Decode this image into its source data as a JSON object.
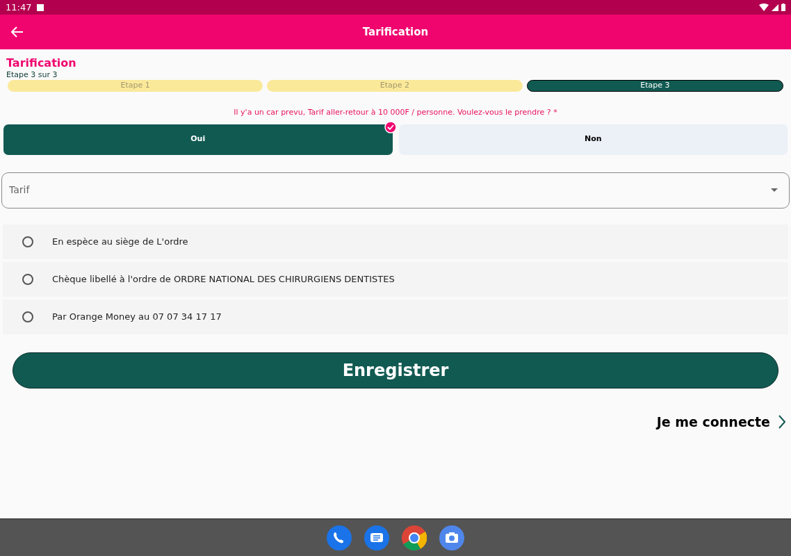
{
  "status_bar": {
    "time": "11:47"
  },
  "app_bar": {
    "title": "Tarification"
  },
  "header": {
    "title": "Tarification",
    "subtitle": "Etape 3 sur 3"
  },
  "steps": [
    {
      "label": "Etape 1",
      "selected": false
    },
    {
      "label": "Etape 2",
      "selected": false
    },
    {
      "label": "Etape 3",
      "selected": true
    }
  ],
  "question": "Il y'a un car prevu, Tarif aller-retour à 10 000F / personne. Voulez-vous le prendre ? *",
  "choices": [
    {
      "label": "Oui",
      "selected": true
    },
    {
      "label": "Non",
      "selected": false
    }
  ],
  "tarif_field": {
    "placeholder": "Tarif"
  },
  "payment_options": [
    {
      "label": "En espèce au siège de L'ordre",
      "selected": false
    },
    {
      "label": "Chèque libellé à l'ordre de ORDRE NATIONAL DES CHIRURGIENS DENTISTES",
      "selected": false
    },
    {
      "label": "Par Orange Money au 07 07 34 17 17",
      "selected": false
    }
  ],
  "save_button": "Enregistrer",
  "login_link": "Je me connecte"
}
